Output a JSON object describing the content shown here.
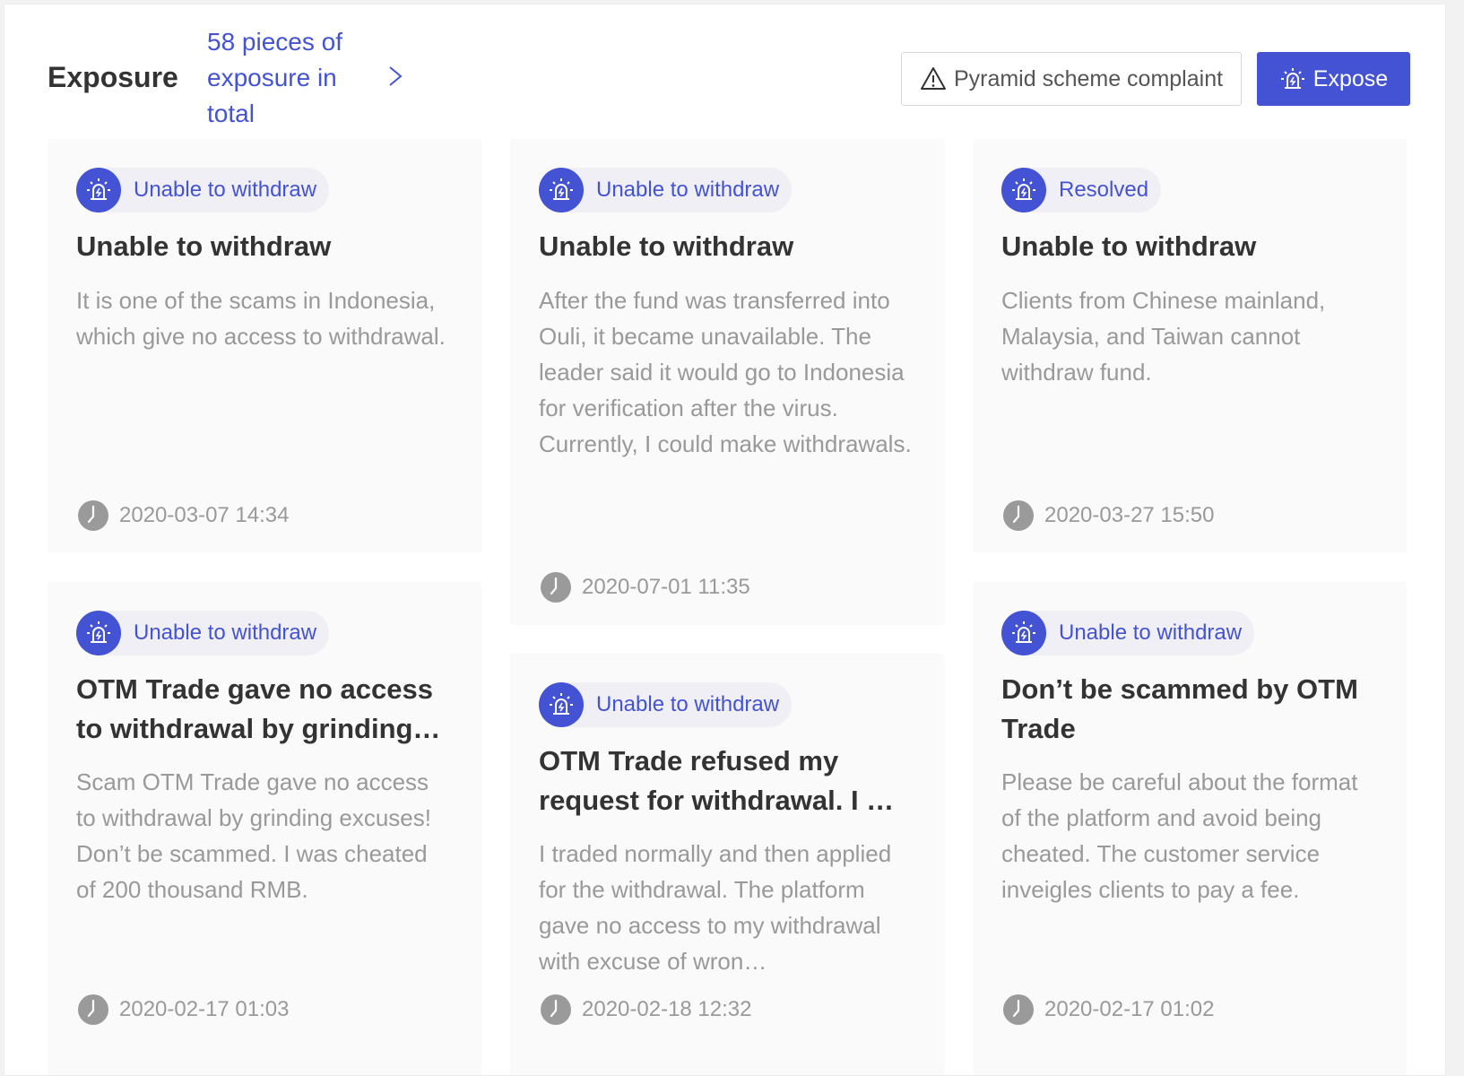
{
  "header": {
    "title": "Exposure",
    "count_link": "58 pieces of exposure in total",
    "complaint_button": "Pyramid scheme complaint",
    "expose_button": "Expose"
  },
  "colors": {
    "accent": "#4353d3",
    "tag_bg": "#efeff5",
    "card_bg": "#fafafa",
    "muted_text": "#999999"
  },
  "icons": {
    "arrow": "chevron-right-icon",
    "complaint": "warning-triangle-icon",
    "expose": "siren-icon",
    "tag": "siren-icon",
    "date": "clock-icon"
  },
  "cards": [
    {
      "tag": "Unable to withdraw",
      "title": "Unable to withdraw",
      "body": "It is one of the scams in Indonesia, which give no access to withdrawal.",
      "date": "2020-03-07 14:34"
    },
    {
      "tag": "Unable to withdraw",
      "title": "Unable to withdraw",
      "body": "After the fund was transferred into Ouli, it became unavailable. The leader said it would go to Indonesia for verification after the virus. Currently, I could make withdrawals.",
      "date": "2020-07-01 11:35"
    },
    {
      "tag": "Resolved",
      "title": "Unable to withdraw",
      "body": "Clients from Chinese mainland, Malaysia, and Taiwan cannot withdraw fund.",
      "date": "2020-03-27 15:50"
    },
    {
      "tag": "Unable to withdraw",
      "title": "OTM Trade gave no access to withdrawal by grinding…",
      "body": "Scam OTM Trade gave no access to withdrawal by grinding excuses! Don’t be scammed. I was cheated of 200 thousand RMB.",
      "date": "2020-02-17 01:03"
    },
    {
      "tag": "Unable to withdraw",
      "title": "OTM Trade refused my request for withdrawal. I …",
      "body": "I traded normally and then applied for the withdrawal. The platform gave no access to my withdrawal with excuse of wron…",
      "date": "2020-02-18 12:32"
    },
    {
      "tag": "Unable to withdraw",
      "title": "Don’t be scammed by OTM Trade",
      "body": "Please be careful about the format of the platform and avoid being cheated. The customer service inveigles clients to pay a fee.",
      "date": "2020-02-17 01:02"
    }
  ]
}
